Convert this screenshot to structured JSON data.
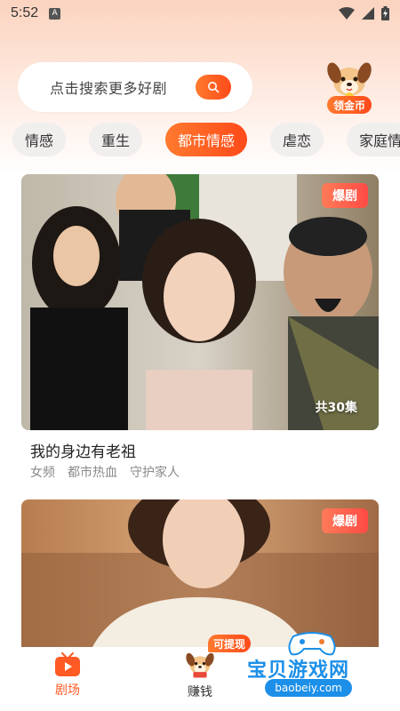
{
  "status_bar": {
    "time": "5:52",
    "app_indicator": "A"
  },
  "search": {
    "placeholder": "点击搜索更多好剧"
  },
  "coin_reward": {
    "label": "领金币"
  },
  "categories": [
    {
      "label": "情感",
      "active": false
    },
    {
      "label": "重生",
      "active": false
    },
    {
      "label": "都市情感",
      "active": true
    },
    {
      "label": "虐恋",
      "active": false
    },
    {
      "label": "家庭情"
    }
  ],
  "dramas": [
    {
      "badge": "爆剧",
      "episodes": "共30集",
      "title": "我的身边有老祖",
      "tags": [
        "女频",
        "都市热血",
        "守护家人"
      ]
    },
    {
      "badge": "爆剧"
    }
  ],
  "bottom_nav": {
    "theater_label": "剧场",
    "earn_label": "赚钱",
    "withdraw_badge": "可提现"
  },
  "watermark": {
    "text": "宝贝游戏网",
    "url": "baobeiy.com"
  },
  "colors": {
    "accent": "#ff5a24",
    "accent_gradient_start": "#ff7a2e",
    "badge": "#ff4b45"
  }
}
